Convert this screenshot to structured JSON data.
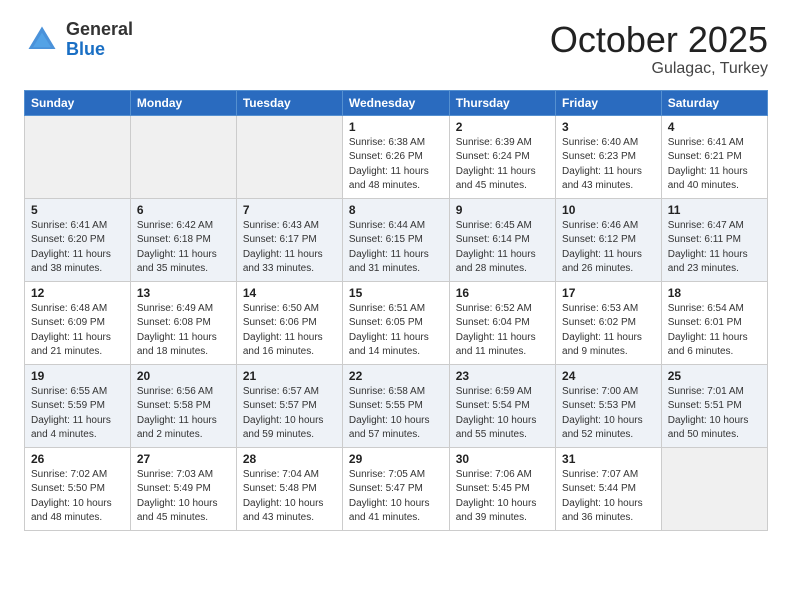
{
  "header": {
    "logo_general": "General",
    "logo_blue": "Blue",
    "month_title": "October 2025",
    "location": "Gulagac, Turkey"
  },
  "calendar": {
    "weekdays": [
      "Sunday",
      "Monday",
      "Tuesday",
      "Wednesday",
      "Thursday",
      "Friday",
      "Saturday"
    ],
    "weeks": [
      [
        {
          "day": "",
          "info": ""
        },
        {
          "day": "",
          "info": ""
        },
        {
          "day": "",
          "info": ""
        },
        {
          "day": "1",
          "info": "Sunrise: 6:38 AM\nSunset: 6:26 PM\nDaylight: 11 hours\nand 48 minutes."
        },
        {
          "day": "2",
          "info": "Sunrise: 6:39 AM\nSunset: 6:24 PM\nDaylight: 11 hours\nand 45 minutes."
        },
        {
          "day": "3",
          "info": "Sunrise: 6:40 AM\nSunset: 6:23 PM\nDaylight: 11 hours\nand 43 minutes."
        },
        {
          "day": "4",
          "info": "Sunrise: 6:41 AM\nSunset: 6:21 PM\nDaylight: 11 hours\nand 40 minutes."
        }
      ],
      [
        {
          "day": "5",
          "info": "Sunrise: 6:41 AM\nSunset: 6:20 PM\nDaylight: 11 hours\nand 38 minutes."
        },
        {
          "day": "6",
          "info": "Sunrise: 6:42 AM\nSunset: 6:18 PM\nDaylight: 11 hours\nand 35 minutes."
        },
        {
          "day": "7",
          "info": "Sunrise: 6:43 AM\nSunset: 6:17 PM\nDaylight: 11 hours\nand 33 minutes."
        },
        {
          "day": "8",
          "info": "Sunrise: 6:44 AM\nSunset: 6:15 PM\nDaylight: 11 hours\nand 31 minutes."
        },
        {
          "day": "9",
          "info": "Sunrise: 6:45 AM\nSunset: 6:14 PM\nDaylight: 11 hours\nand 28 minutes."
        },
        {
          "day": "10",
          "info": "Sunrise: 6:46 AM\nSunset: 6:12 PM\nDaylight: 11 hours\nand 26 minutes."
        },
        {
          "day": "11",
          "info": "Sunrise: 6:47 AM\nSunset: 6:11 PM\nDaylight: 11 hours\nand 23 minutes."
        }
      ],
      [
        {
          "day": "12",
          "info": "Sunrise: 6:48 AM\nSunset: 6:09 PM\nDaylight: 11 hours\nand 21 minutes."
        },
        {
          "day": "13",
          "info": "Sunrise: 6:49 AM\nSunset: 6:08 PM\nDaylight: 11 hours\nand 18 minutes."
        },
        {
          "day": "14",
          "info": "Sunrise: 6:50 AM\nSunset: 6:06 PM\nDaylight: 11 hours\nand 16 minutes."
        },
        {
          "day": "15",
          "info": "Sunrise: 6:51 AM\nSunset: 6:05 PM\nDaylight: 11 hours\nand 14 minutes."
        },
        {
          "day": "16",
          "info": "Sunrise: 6:52 AM\nSunset: 6:04 PM\nDaylight: 11 hours\nand 11 minutes."
        },
        {
          "day": "17",
          "info": "Sunrise: 6:53 AM\nSunset: 6:02 PM\nDaylight: 11 hours\nand 9 minutes."
        },
        {
          "day": "18",
          "info": "Sunrise: 6:54 AM\nSunset: 6:01 PM\nDaylight: 11 hours\nand 6 minutes."
        }
      ],
      [
        {
          "day": "19",
          "info": "Sunrise: 6:55 AM\nSunset: 5:59 PM\nDaylight: 11 hours\nand 4 minutes."
        },
        {
          "day": "20",
          "info": "Sunrise: 6:56 AM\nSunset: 5:58 PM\nDaylight: 11 hours\nand 2 minutes."
        },
        {
          "day": "21",
          "info": "Sunrise: 6:57 AM\nSunset: 5:57 PM\nDaylight: 10 hours\nand 59 minutes."
        },
        {
          "day": "22",
          "info": "Sunrise: 6:58 AM\nSunset: 5:55 PM\nDaylight: 10 hours\nand 57 minutes."
        },
        {
          "day": "23",
          "info": "Sunrise: 6:59 AM\nSunset: 5:54 PM\nDaylight: 10 hours\nand 55 minutes."
        },
        {
          "day": "24",
          "info": "Sunrise: 7:00 AM\nSunset: 5:53 PM\nDaylight: 10 hours\nand 52 minutes."
        },
        {
          "day": "25",
          "info": "Sunrise: 7:01 AM\nSunset: 5:51 PM\nDaylight: 10 hours\nand 50 minutes."
        }
      ],
      [
        {
          "day": "26",
          "info": "Sunrise: 7:02 AM\nSunset: 5:50 PM\nDaylight: 10 hours\nand 48 minutes."
        },
        {
          "day": "27",
          "info": "Sunrise: 7:03 AM\nSunset: 5:49 PM\nDaylight: 10 hours\nand 45 minutes."
        },
        {
          "day": "28",
          "info": "Sunrise: 7:04 AM\nSunset: 5:48 PM\nDaylight: 10 hours\nand 43 minutes."
        },
        {
          "day": "29",
          "info": "Sunrise: 7:05 AM\nSunset: 5:47 PM\nDaylight: 10 hours\nand 41 minutes."
        },
        {
          "day": "30",
          "info": "Sunrise: 7:06 AM\nSunset: 5:45 PM\nDaylight: 10 hours\nand 39 minutes."
        },
        {
          "day": "31",
          "info": "Sunrise: 7:07 AM\nSunset: 5:44 PM\nDaylight: 10 hours\nand 36 minutes."
        },
        {
          "day": "",
          "info": ""
        }
      ]
    ]
  }
}
